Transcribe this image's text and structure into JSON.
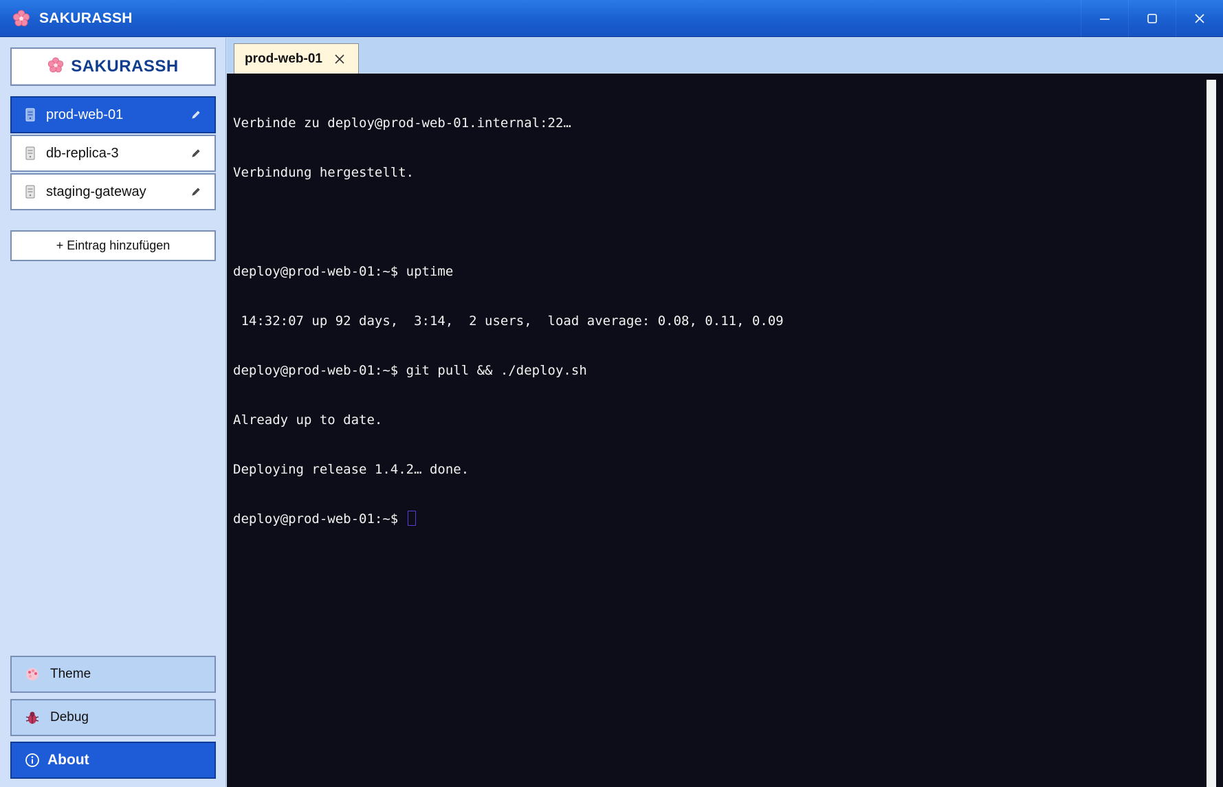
{
  "window": {
    "title": "SAKURASSH",
    "controls": [
      "minimize-icon",
      "maximize-icon",
      "close-icon"
    ]
  },
  "sidebar": {
    "brand": "SAKURASSH",
    "hosts": [
      {
        "label": "prod-web-01",
        "active": true
      },
      {
        "label": "db-replica-3",
        "active": false
      },
      {
        "label": "staging-gateway",
        "active": false
      }
    ],
    "add_entry_label": "+ Eintrag hinzufügen",
    "bottom": {
      "theme_label": "Theme",
      "debug_label": "Debug",
      "about_label": "About"
    }
  },
  "tabs": [
    {
      "label": "prod-web-01",
      "active": true
    }
  ],
  "terminal": {
    "lines": [
      "Verbinde zu deploy@prod-web-01.internal:22…",
      "Verbindung hergestellt.",
      "",
      "deploy@prod-web-01:~$ uptime",
      " 14:32:07 up 92 days,  3:14,  2 users,  load average: 0.08, 0.11, 0.09",
      "deploy@prod-web-01:~$ git pull && ./deploy.sh",
      "Already up to date.",
      "Deploying release 1.4.2… done."
    ],
    "prompt": "deploy@prod-web-01:~$ "
  },
  "colors": {
    "accent": "#1e5bd6",
    "sidebar_bg": "#cfe0f8",
    "terminal_bg": "#0c0d18",
    "brand_text": "#103d8f",
    "tab_bg": "#fff6dc"
  }
}
